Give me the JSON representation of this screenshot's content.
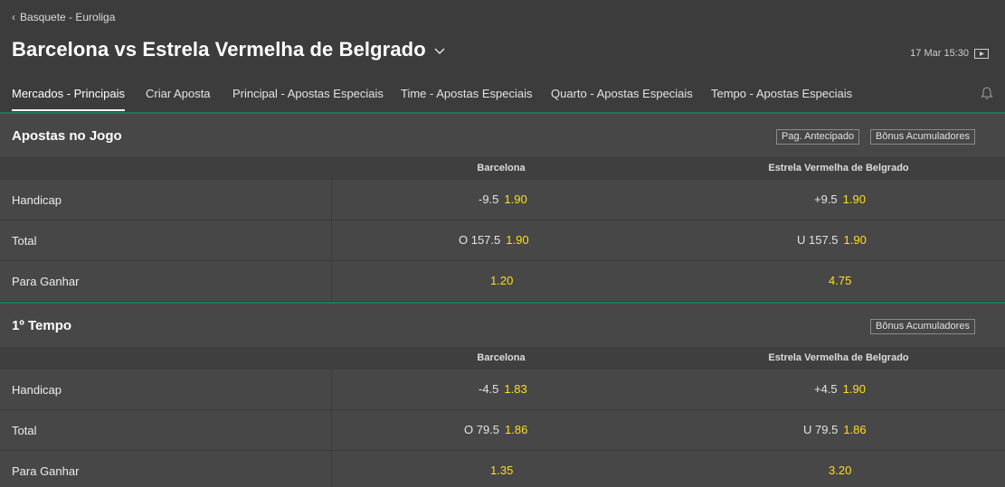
{
  "breadcrumb": {
    "label": "Basquete - Euroliga"
  },
  "event": {
    "title": "Barcelona vs Estrela Vermelha de Belgrado",
    "datetime": "17 Mar 15:30"
  },
  "tabs": [
    {
      "label": "Mercados - Principais"
    },
    {
      "label": "Criar Aposta"
    },
    {
      "label": "Principal - Apostas Especiais"
    },
    {
      "label": "Time - Apostas Especiais"
    },
    {
      "label": "Quarto - Apostas Especiais"
    },
    {
      "label": "Tempo - Apostas Especiais"
    }
  ],
  "sections": [
    {
      "title": "Apostas no Jogo",
      "chips": [
        "Pag. Antecipado",
        "Bônus Acumuladores"
      ],
      "columns": [
        "Barcelona",
        "Estrela Vermelha de Belgrado"
      ],
      "rows": [
        {
          "label": "Handicap",
          "home_line": "-9.5",
          "home_odd": "1.90",
          "away_line": "+9.5",
          "away_odd": "1.90"
        },
        {
          "label": "Total",
          "home_line": "O 157.5",
          "home_odd": "1.90",
          "away_line": "U 157.5",
          "away_odd": "1.90"
        },
        {
          "label": "Para Ganhar",
          "home_line": "",
          "home_odd": "1.20",
          "away_line": "",
          "away_odd": "4.75"
        }
      ]
    },
    {
      "title": "1º Tempo",
      "chips": [
        "Bônus Acumuladores"
      ],
      "columns": [
        "Barcelona",
        "Estrela Vermelha de Belgrado"
      ],
      "rows": [
        {
          "label": "Handicap",
          "home_line": "-4.5",
          "home_odd": "1.83",
          "away_line": "+4.5",
          "away_odd": "1.90"
        },
        {
          "label": "Total",
          "home_line": "O 79.5",
          "home_odd": "1.86",
          "away_line": "U 79.5",
          "away_odd": "1.86"
        },
        {
          "label": "Para Ganhar",
          "home_line": "",
          "home_odd": "1.35",
          "away_line": "",
          "away_odd": "3.20"
        }
      ]
    }
  ],
  "colors": {
    "odd": "#ffdf1b",
    "accent_green": "#1b7a55",
    "header_bg": "#3c3c3c",
    "body_bg": "#474747"
  }
}
